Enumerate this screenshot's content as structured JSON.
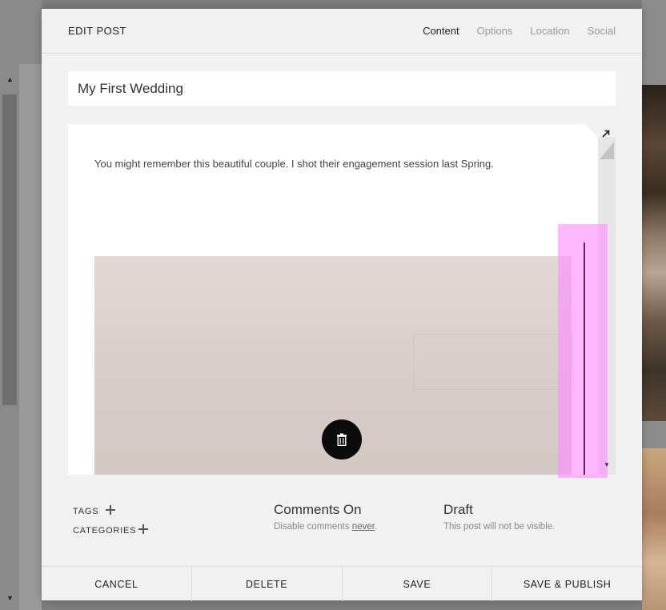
{
  "modal": {
    "title": "EDIT POST",
    "tabs": [
      {
        "label": "Content",
        "active": true
      },
      {
        "label": "Options",
        "active": false
      },
      {
        "label": "Location",
        "active": false
      },
      {
        "label": "Social",
        "active": false
      }
    ]
  },
  "post": {
    "title_value": "My First Wedding",
    "body_text": "You might remember this beautiful couple.  I shot their engagement session last Spring."
  },
  "editor": {
    "icons": [
      "trash-icon",
      "expand-icon",
      "resize-handle",
      "scroll-down-arrow"
    ],
    "highlight_color": "#ff8cff"
  },
  "meta": {
    "tags_label": "TAGS",
    "categories_label": "CATEGORIES",
    "comments": {
      "heading": "Comments On",
      "prefix": "Disable comments ",
      "link": "never",
      "suffix": "."
    },
    "status": {
      "heading": "Draft",
      "description": "This post will not be visible."
    }
  },
  "footer": {
    "cancel": "CANCEL",
    "delete": "DELETE",
    "save": "SAVE",
    "save_publish": "SAVE & PUBLISH"
  }
}
